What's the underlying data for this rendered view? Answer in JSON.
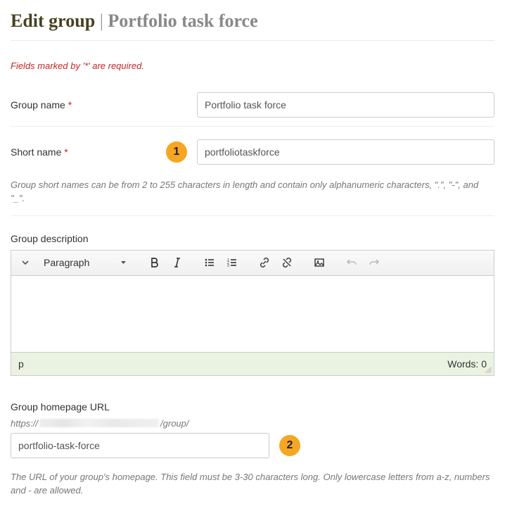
{
  "header": {
    "title": "Edit group",
    "separator": "|",
    "subtitle": "Portfolio task force"
  },
  "required_note": "Fields marked by '*' are required.",
  "group_name": {
    "label": "Group name",
    "value": "Portfolio task force"
  },
  "short_name": {
    "label": "Short name",
    "value": "portfoliotaskforce",
    "help": "Group short names can be from 2 to 255 characters in length and contain only alphanumeric characters, \".\", \"-\", and \"_\"."
  },
  "description": {
    "label": "Group description",
    "format_label": "Paragraph",
    "path": "p",
    "word_count": "Words: 0"
  },
  "homepage": {
    "label": "Group homepage URL",
    "prefix_proto": "https://",
    "prefix_suffix": "/group/",
    "value": "portfolio-task-force",
    "help": "The URL of your group's homepage. This field must be 3-30 characters long. Only lowercase letters from a-z, numbers and - are allowed."
  },
  "callouts": {
    "one": "1",
    "two": "2"
  }
}
